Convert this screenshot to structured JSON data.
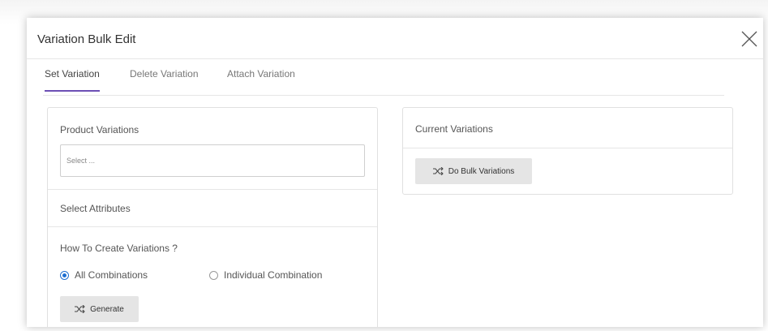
{
  "modal": {
    "title": "Variation Bulk Edit"
  },
  "tabs": [
    {
      "label": "Set Variation",
      "active": true
    },
    {
      "label": "Delete Variation",
      "active": false
    },
    {
      "label": "Attach Variation",
      "active": false
    }
  ],
  "left_panel": {
    "product_variations_label": "Product Variations",
    "select_placeholder": "Select ...",
    "select_attributes_label": "Select Attributes",
    "how_to_create_label": "How To Create Variations ?",
    "options": [
      {
        "label": "All Combinations",
        "checked": true
      },
      {
        "label": "Individual Combination",
        "checked": false
      }
    ],
    "generate_label": "Generate"
  },
  "right_panel": {
    "current_variations_label": "Current Variations",
    "bulk_button_label": "Do Bulk Variations"
  },
  "colors": {
    "accent": "#6c4fb5",
    "radio": "#1f6fd1"
  }
}
